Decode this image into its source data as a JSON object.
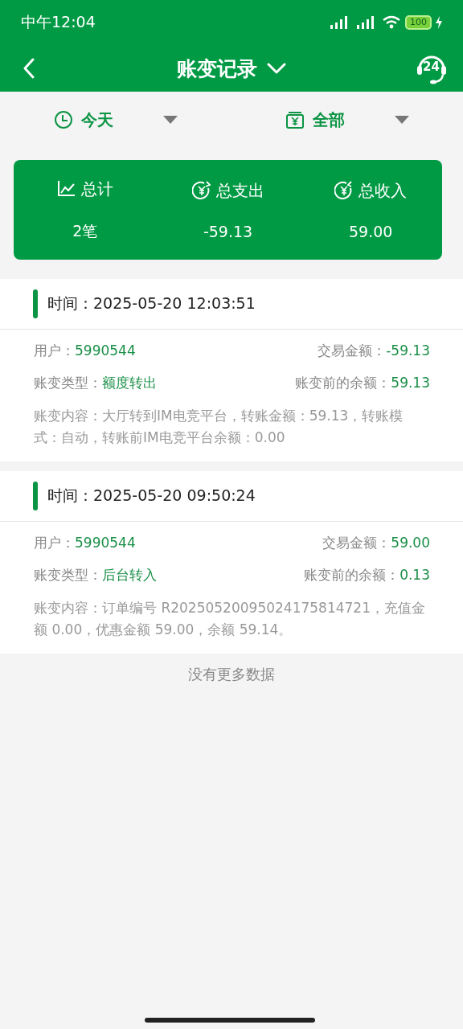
{
  "status_bar": {
    "time": "中午12:04",
    "battery": "100"
  },
  "header": {
    "title": "账变记录",
    "service_badge": "24"
  },
  "filters": [
    {
      "kind": "time",
      "label": "今天"
    },
    {
      "kind": "type",
      "label": "全部"
    }
  ],
  "summary": [
    {
      "kind": "count",
      "label": "总计",
      "value": "2笔"
    },
    {
      "kind": "expense",
      "label": "总支出",
      "value": "-59.13"
    },
    {
      "kind": "income",
      "label": "总收入",
      "value": "59.00"
    }
  ],
  "records": [
    {
      "time": "时间：2025-05-20 12:03:51",
      "user_label": "用户：",
      "user": "5990544",
      "amount_label": "交易金额：",
      "amount": "-59.13",
      "type_label": "账变类型：",
      "type": "额度转出",
      "balance_label": "账变前的余额：",
      "balance": "59.13",
      "content": "账变内容：大厅转到IM电竞平台，转账金额：59.13，转账模式：自动，转账前IM电竞平台余额：0.00"
    },
    {
      "time": "时间：2025-05-20 09:50:24",
      "user_label": "用户：",
      "user": "5990544",
      "amount_label": "交易金额：",
      "amount": "59.00",
      "type_label": "账变类型：",
      "type": "后台转入",
      "balance_label": "账变前的余额：",
      "balance": "0.13",
      "content": "账变内容：订单编号 R20250520095024175814721，充值金额 0.00，优惠金额 59.00，余额 59.14。"
    }
  ],
  "footer": "没有更多数据"
}
